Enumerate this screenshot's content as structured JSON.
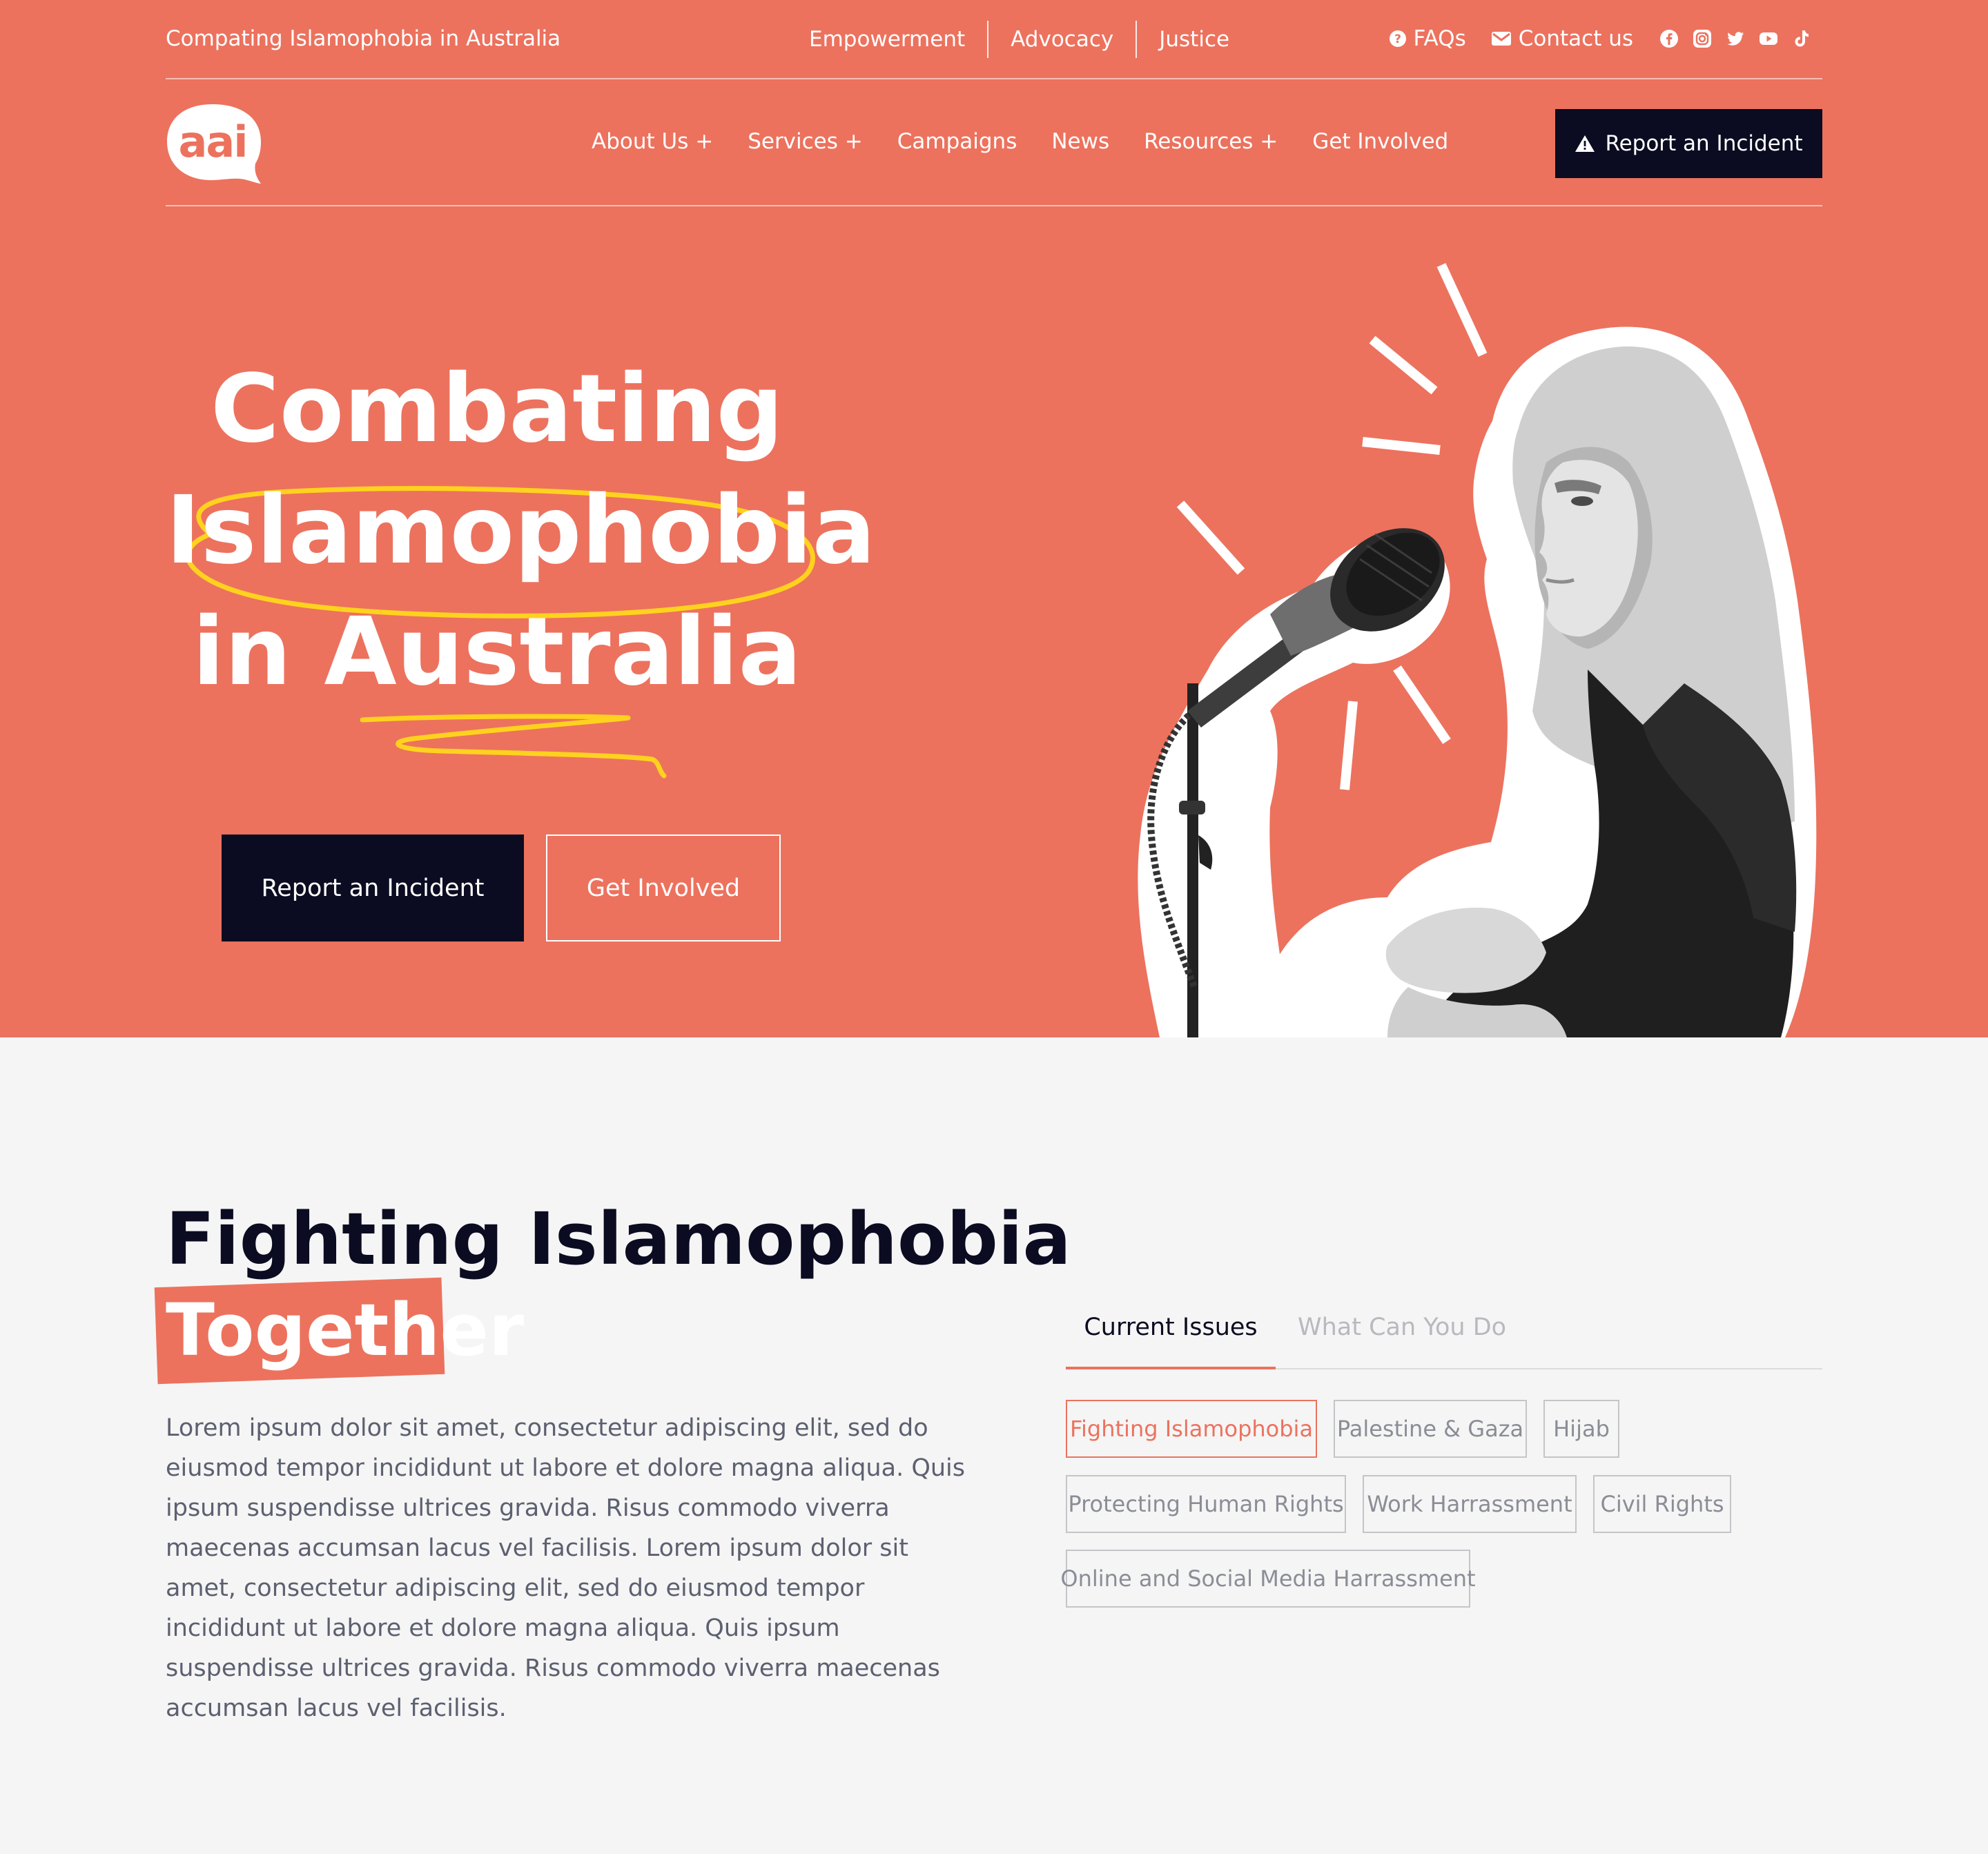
{
  "topbar": {
    "tagline": "Compating Islamophobia in Australia",
    "pillars": [
      "Empowerment",
      "Advocacy",
      "Justice"
    ],
    "faqs": "FAQs",
    "contact": "Contact us",
    "social_icons": [
      "facebook-icon",
      "instagram-icon",
      "twitter-icon",
      "youtube-icon",
      "tiktok-icon"
    ]
  },
  "nav": {
    "logo_text": "aai",
    "links": [
      "About Us +",
      "Services +",
      "Campaigns",
      "News",
      "Resources +",
      "Get Involved"
    ],
    "report_button": "Report an Incident"
  },
  "hero": {
    "title_lines": [
      "Combating",
      "Islamophobia",
      "in Australia"
    ],
    "primary_button": "Report an Incident",
    "secondary_button": "Get Involved"
  },
  "section": {
    "title_line1": "Fighting Islamophobia",
    "title_line2": "Together",
    "body": "Lorem ipsum dolor sit amet, consectetur adipiscing elit, sed do eiusmod tempor incididunt ut labore et dolore magna aliqua. Quis ipsum suspendisse ultrices gravida. Risus commodo viverra maecenas accumsan lacus vel facilisis.  Lorem ipsum dolor sit amet, consectetur adipiscing elit, sed do eiusmod tempor incididunt ut labore et dolore magna aliqua. Quis ipsum suspendisse ultrices gravida. Risus commodo viverra maecenas accumsan lacus vel facilisis."
  },
  "tabs": {
    "items": [
      "Current Issues",
      "What Can You Do"
    ],
    "active": "Current Issues"
  },
  "issues": [
    "Fighting Islamophobia",
    "Palestine & Gaza",
    "Hijab",
    "Protecting Human Rights",
    "Work Harrassment",
    "Civil Rights",
    "Online and Social Media Harrassment"
  ],
  "colors": {
    "brand_coral": "#ec725e",
    "navy": "#0b0c21",
    "highlight_yellow": "#ffd21e",
    "page_bg": "#f5f5f5"
  }
}
